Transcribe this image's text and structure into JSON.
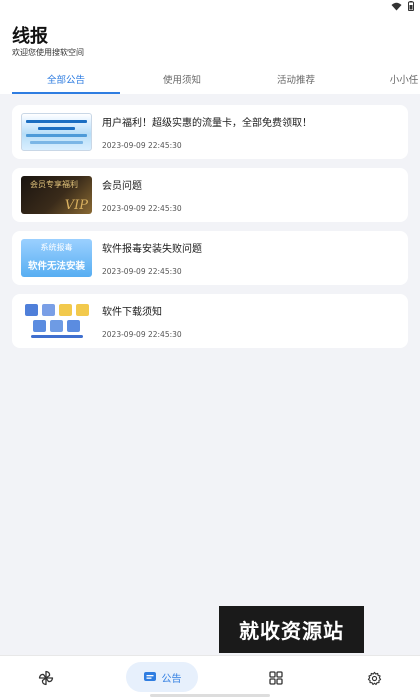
{
  "header": {
    "title": "线报",
    "subtitle": "欢迎您使用搜软空间"
  },
  "tabs": [
    {
      "label": "全部公告",
      "active": true
    },
    {
      "label": "使用须知",
      "active": false
    },
    {
      "label": "活动推荐",
      "active": false
    },
    {
      "label": "小小任",
      "active": false
    }
  ],
  "announcements": [
    {
      "title": "用户福利！超级实惠的流量卡，全部免费领取！",
      "time": "2023-09-09 22:45:30",
      "thumbnail_icon": "free-data-card-banner"
    },
    {
      "title": "会员问题",
      "time": "2023-09-09 22:45:30",
      "thumbnail_icon": "vip-banner",
      "thumbnail_text": [
        "会员专享福利",
        "VIP"
      ]
    },
    {
      "title": "软件报毒安装失败问题",
      "time": "2023-09-09 22:45:30",
      "thumbnail_icon": "system-alert-banner",
      "thumbnail_text": [
        "系统报毒",
        "软件无法安装"
      ]
    },
    {
      "title": "软件下载须知",
      "time": "2023-09-09 22:45:30",
      "thumbnail_icon": "app-grid-banner"
    }
  ],
  "watermark": "就收资源站",
  "bottom_nav": {
    "items": [
      {
        "icon": "pinwheel-icon"
      },
      {
        "icon": "message-icon",
        "label": "公告",
        "active": true
      },
      {
        "icon": "apps-icon"
      },
      {
        "icon": "gear-icon"
      }
    ]
  },
  "colors": {
    "accent": "#2f7de1",
    "background": "#f2f3f7",
    "card": "#ffffff",
    "active_pill": "#e7f0fc"
  }
}
